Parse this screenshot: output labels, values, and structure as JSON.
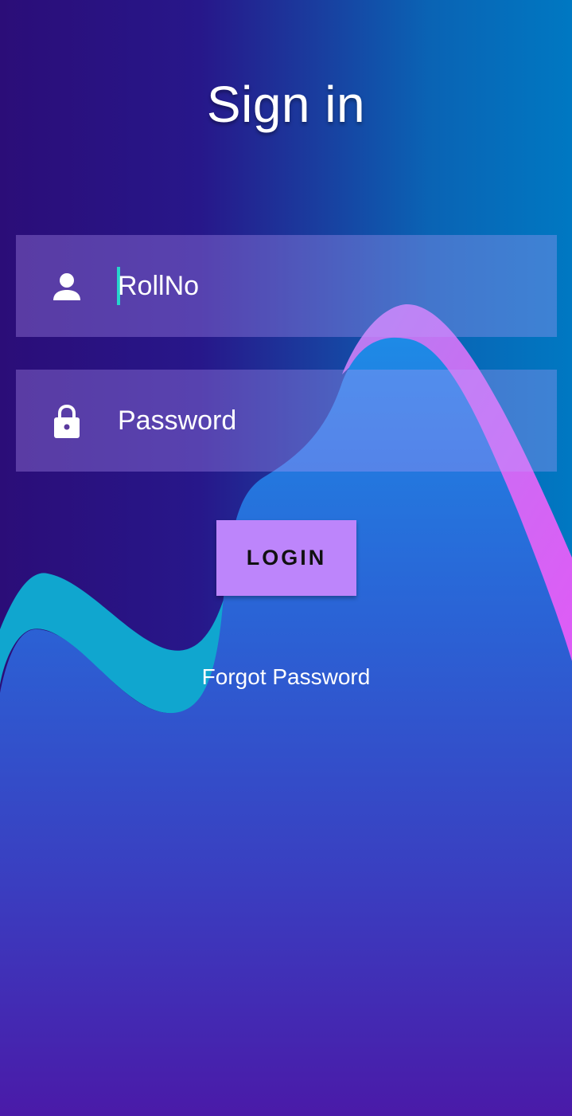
{
  "title": "Sign in",
  "fields": {
    "rollno": {
      "placeholder": "RollNo",
      "value": "",
      "icon": "person-icon"
    },
    "password": {
      "placeholder": "Password",
      "value": "",
      "icon": "lock-icon"
    }
  },
  "login_label": "LOGIN",
  "forgot_label": "Forgot Password",
  "colors": {
    "button": "#bd85fb",
    "cursor": "#26d4cc",
    "wave_cyan": "#0fa9d0",
    "wave_pink": "#d956f4",
    "wave_blue": "#1a78e0",
    "bottom_purple": "#4a1aa8"
  }
}
